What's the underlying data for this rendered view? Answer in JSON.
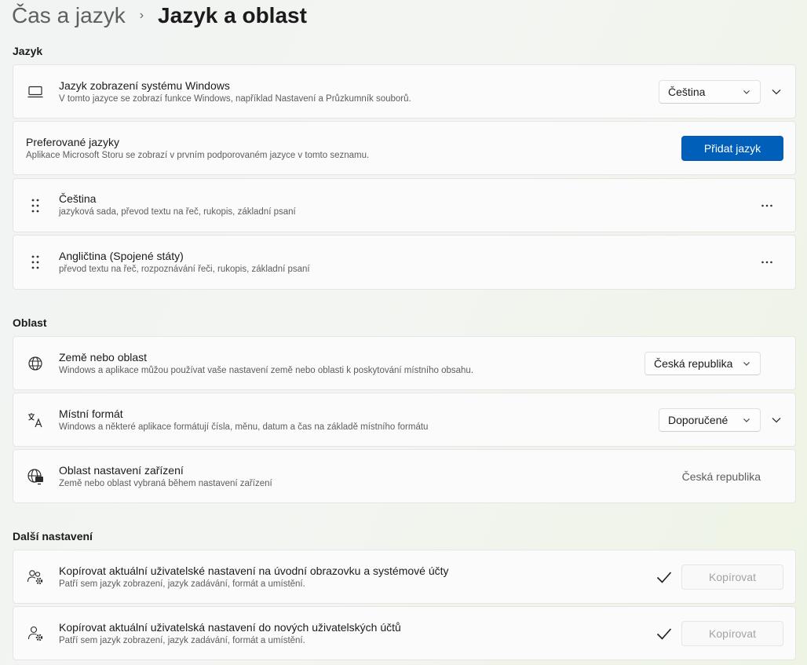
{
  "breadcrumb": {
    "parent": "Čas a jazyk",
    "separator": "›",
    "current": "Jazyk a oblast"
  },
  "sections": {
    "language": "Jazyk",
    "region": "Oblast",
    "more": "Další nastavení"
  },
  "display_language": {
    "title": "Jazyk zobrazení systému Windows",
    "desc": "V tomto jazyce se zobrazí funkce Windows, například Nastavení a Průzkumník souborů.",
    "value": "Čeština",
    "icon": "laptop-icon"
  },
  "preferred": {
    "title": "Preferované jazyky",
    "desc": "Aplikace Microsoft Storu se zobrazí v prvním podporovaném jazyce v tomto seznamu.",
    "button": "Přidat jazyk"
  },
  "languages": [
    {
      "name": "Čeština",
      "features": "jazyková sada, převod textu na řeč, rukopis, základní psaní"
    },
    {
      "name": "Angličtina (Spojené státy)",
      "features": "převod textu na řeč, rozpoznávání řeči, rukopis, základní psaní"
    }
  ],
  "country": {
    "title": "Země nebo oblast",
    "desc": "Windows a aplikace můžou používat vaše nastavení země nebo oblasti k poskytování místního obsahu.",
    "value": "Česká republika",
    "icon": "globe-icon"
  },
  "regional_format": {
    "title": "Místní formát",
    "desc": "Windows a některé aplikace formátují čísla, měnu, datum a čas na základě místního formátu",
    "value": "Doporučené",
    "icon": "language-format-icon"
  },
  "setup_region": {
    "title": "Oblast nastavení zařízení",
    "desc": "Země nebo oblast vybraná během nastavení zařízení",
    "value": "Česká republika",
    "icon": "globe-desktop-icon"
  },
  "copy_welcome": {
    "title": "Kopírovat aktuální uživatelské nastavení na úvodní obrazovku a systémové účty",
    "desc": "Patří sem jazyk zobrazení, jazyk zadávání, formát a umístění.",
    "button": "Kopírovat",
    "icon": "people-settings-icon"
  },
  "copy_new": {
    "title": "Kopírovat aktuální uživatelská nastavení do nových uživatelských účtů",
    "desc": "Patří sem jazyk zobrazení, jazyk zadávání, formát a umístění.",
    "button": "Kopírovat",
    "icon": "person-settings-icon"
  },
  "colors": {
    "accent": "#005fb8",
    "card": "#fbfbfb",
    "border": "#e5e5e5"
  }
}
